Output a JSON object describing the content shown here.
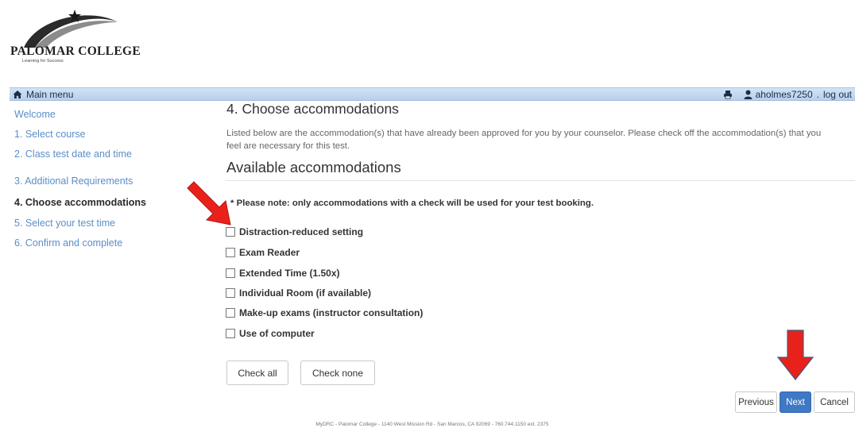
{
  "logo": {
    "name": "PALOMAR COLLEGE",
    "tagline": "Learning for Success"
  },
  "topbar": {
    "main_menu": "Main menu",
    "username": "aholmes7250",
    "separator": ".",
    "logout": "log out",
    "icons": {
      "home": "home-icon",
      "print": "printer-icon",
      "user": "user-icon"
    }
  },
  "sidebar": {
    "items": [
      {
        "label": "Welcome",
        "active": false
      },
      {
        "label": "1. Select course",
        "active": false
      },
      {
        "label": "2. Class test date and time",
        "active": false
      },
      {
        "label": "3. Additional Requirements",
        "active": false
      },
      {
        "label": "4. Choose accommodations",
        "active": true
      },
      {
        "label": "5. Select your test time",
        "active": false
      },
      {
        "label": "6. Confirm and complete",
        "active": false
      }
    ]
  },
  "main": {
    "title": "4. Choose accommodations",
    "intro": "Listed below are the accommodation(s) that have already been approved for you by your counselor. Please check off the accommodation(s) that you feel are necessary for this test.",
    "section_title": "Available accommodations",
    "note": "* Please note: only accommodations with a check will be used for your test booking.",
    "accommodations": [
      {
        "label": "Distraction-reduced setting",
        "checked": false
      },
      {
        "label": "Exam Reader",
        "checked": false
      },
      {
        "label": "Extended Time (1.50x)",
        "checked": false
      },
      {
        "label": "Individual Room (if available)",
        "checked": false
      },
      {
        "label": "Make-up exams (instructor consultation)",
        "checked": false
      },
      {
        "label": "Use of computer",
        "checked": false
      }
    ],
    "check_all": "Check all",
    "check_none": "Check none",
    "previous": "Previous",
    "next": "Next",
    "cancel": "Cancel"
  },
  "footer": "MyDRC - Palomar College - 1140 West Mission Rd - San Marcos, CA 92069 - 760.744.1150 ext. 2375",
  "colors": {
    "link": "#5b8ec8",
    "primary_button": "#3f78c3",
    "annotation_arrow": "#e8221b",
    "topbar": "#c4d8f0"
  }
}
